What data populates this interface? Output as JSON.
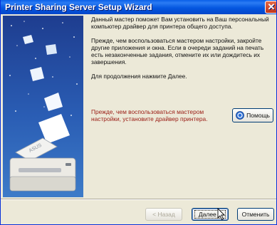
{
  "window": {
    "title": "Printer Sharing Server Setup Wizard",
    "close_symbol": "✕"
  },
  "content": {
    "paragraphs": [
      "Данный мастер поможет Вам установить на Ваш персональный компьютер драйвер для принтера общего доступа.",
      "Прежде, чем воспользоваться мастером настройки, закройте другие приложения и окна. Если в очереди заданий на печать есть незаконченные задания, отмените их или дождитесь их завершения.",
      "Для продолжения нажмите Далее."
    ],
    "warning": "Прежде, чем воспользоваться мастером настройки, установите драйвер принтера.",
    "help_label": "Помощь"
  },
  "buttons": {
    "back": "< Назад",
    "next": "Далее >",
    "cancel": "Отменить"
  },
  "side_panel": {
    "printer_brand": "ASUS"
  },
  "colors": {
    "title_bar": "#0a5fe8",
    "warning_text": "#9a1c14",
    "side_panel": "#2a5db4"
  }
}
